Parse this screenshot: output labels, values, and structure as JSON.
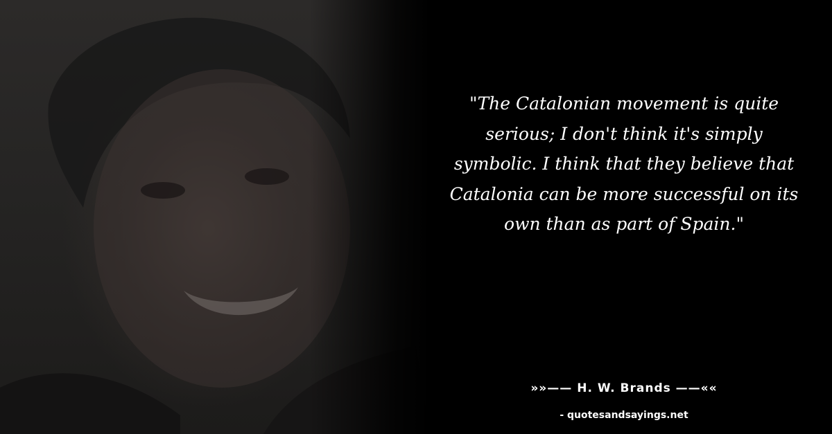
{
  "quote": {
    "text": "\"The Catalonian movement is quite serious; I don't think it's simply symbolic. I think that they believe that Catalonia can be more successful on its own than as part of Spain.\""
  },
  "author": {
    "label": "»»—— H. W. Brands ——««"
  },
  "site": {
    "label": "- quotesandsayings.net"
  },
  "colors": {
    "background": "#000000",
    "text": "#ffffff"
  }
}
